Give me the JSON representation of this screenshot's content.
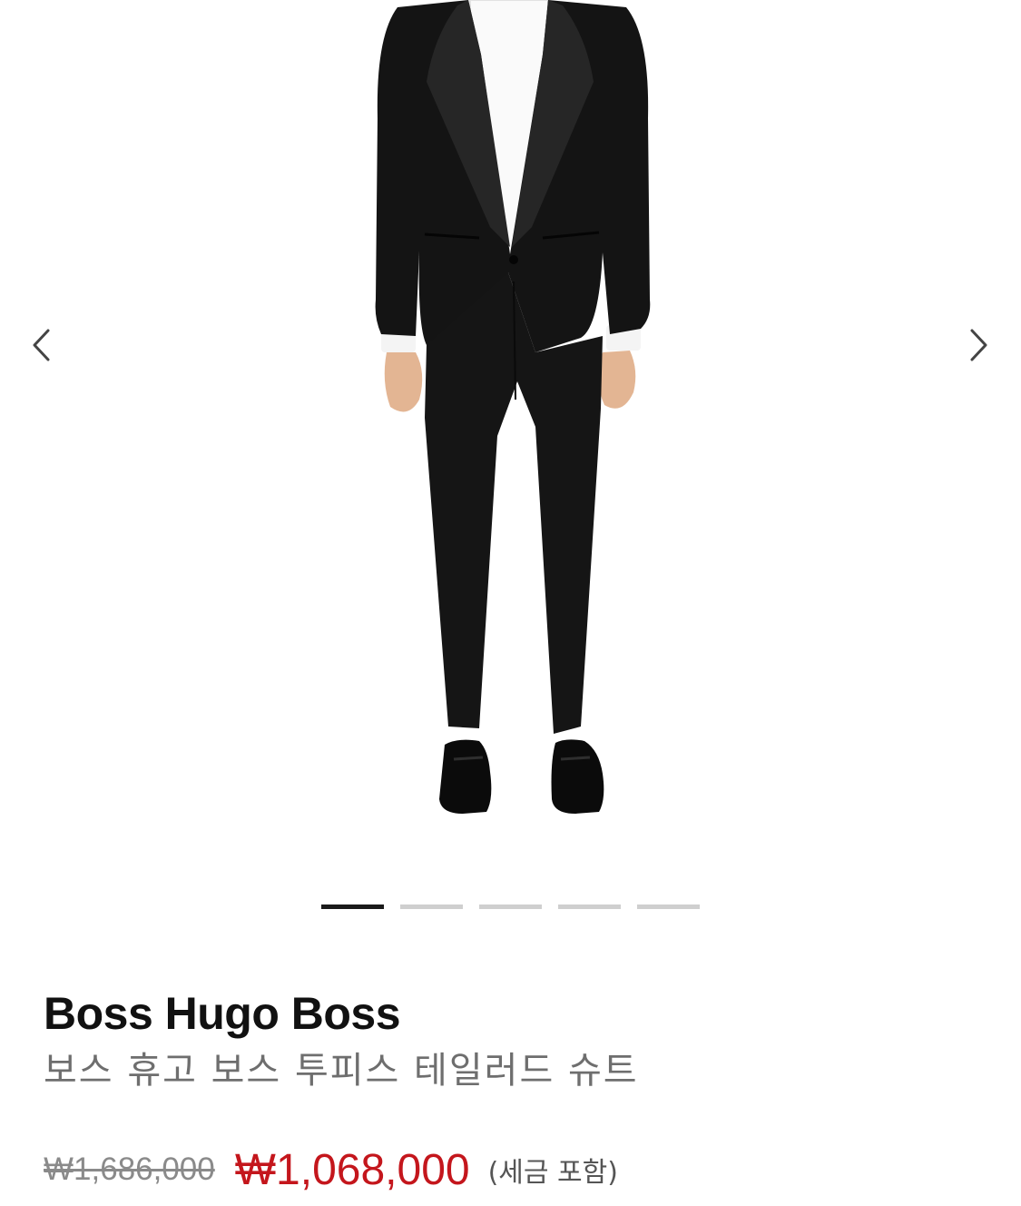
{
  "gallery": {
    "prev_icon": "chevron-left-icon",
    "next_icon": "chevron-right-icon",
    "slides_total": 5,
    "active_slide": 1
  },
  "product": {
    "brand": "Boss Hugo Boss",
    "name": "보스 휴고 보스 투피스 테일러드 슈트",
    "original_price": "₩1,686,000",
    "sale_price": "₩1,068,000",
    "tax_note": "(세금 포함)"
  },
  "colors": {
    "sale_price": "#c4161c",
    "original_price": "#8a8a8a",
    "pager_active": "#1a1a1a",
    "pager_inactive": "#cfcfcf"
  }
}
